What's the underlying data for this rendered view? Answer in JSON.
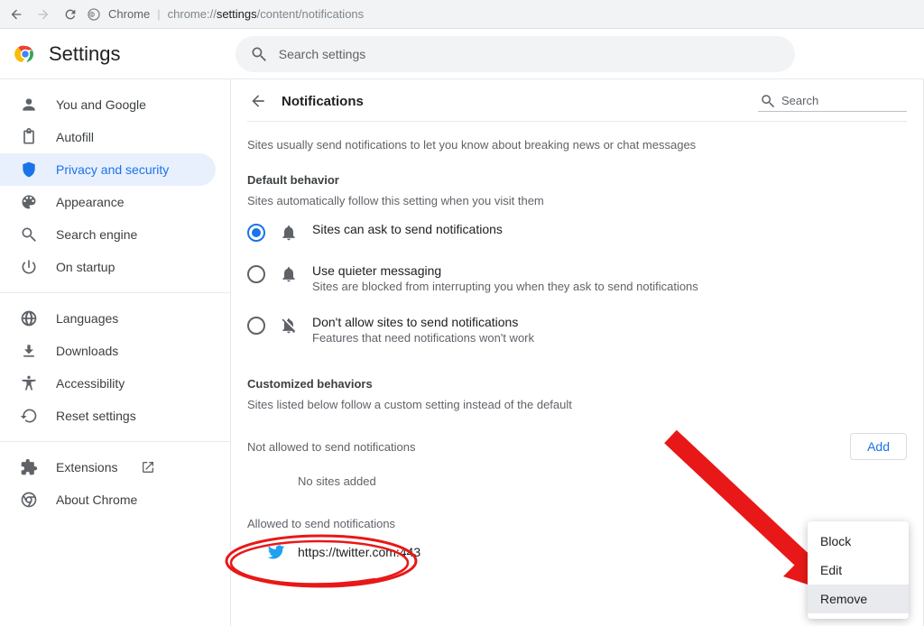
{
  "chrome_bar": {
    "product": "Chrome",
    "url_pre": "chrome://",
    "url_bold": "settings",
    "url_post": "/content/notifications"
  },
  "header": {
    "title": "Settings",
    "search_placeholder": "Search settings"
  },
  "sidebar": {
    "items": [
      {
        "label": "You and Google"
      },
      {
        "label": "Autofill"
      },
      {
        "label": "Privacy and security"
      },
      {
        "label": "Appearance"
      },
      {
        "label": "Search engine"
      },
      {
        "label": "On startup"
      }
    ],
    "adv": [
      {
        "label": "Languages"
      },
      {
        "label": "Downloads"
      },
      {
        "label": "Accessibility"
      },
      {
        "label": "Reset settings"
      }
    ],
    "foot": [
      {
        "label": "Extensions"
      },
      {
        "label": "About Chrome"
      }
    ]
  },
  "main": {
    "page_title": "Notifications",
    "page_search_placeholder": "Search",
    "intro": "Sites usually send notifications to let you know about breaking news or chat messages",
    "default_behavior_title": "Default behavior",
    "default_behavior_sub": "Sites automatically follow this setting when you visit them",
    "options": [
      {
        "line1": "Sites can ask to send notifications",
        "line2": ""
      },
      {
        "line1": "Use quieter messaging",
        "line2": "Sites are blocked from interrupting you when they ask to send notifications"
      },
      {
        "line1": "Don't allow sites to send notifications",
        "line2": "Features that need notifications won't work"
      }
    ],
    "custom_title": "Customized behaviors",
    "custom_sub": "Sites listed below follow a custom setting instead of the default",
    "not_allowed_label": "Not allowed to send notifications",
    "add_label": "Add",
    "no_sites": "No sites added",
    "allowed_label": "Allowed to send notifications",
    "allowed_sites": [
      {
        "url": "https://twitter.com:443"
      }
    ]
  },
  "popup": {
    "items": [
      "Block",
      "Edit",
      "Remove"
    ]
  },
  "colors": {
    "accent": "#1a73e8"
  }
}
